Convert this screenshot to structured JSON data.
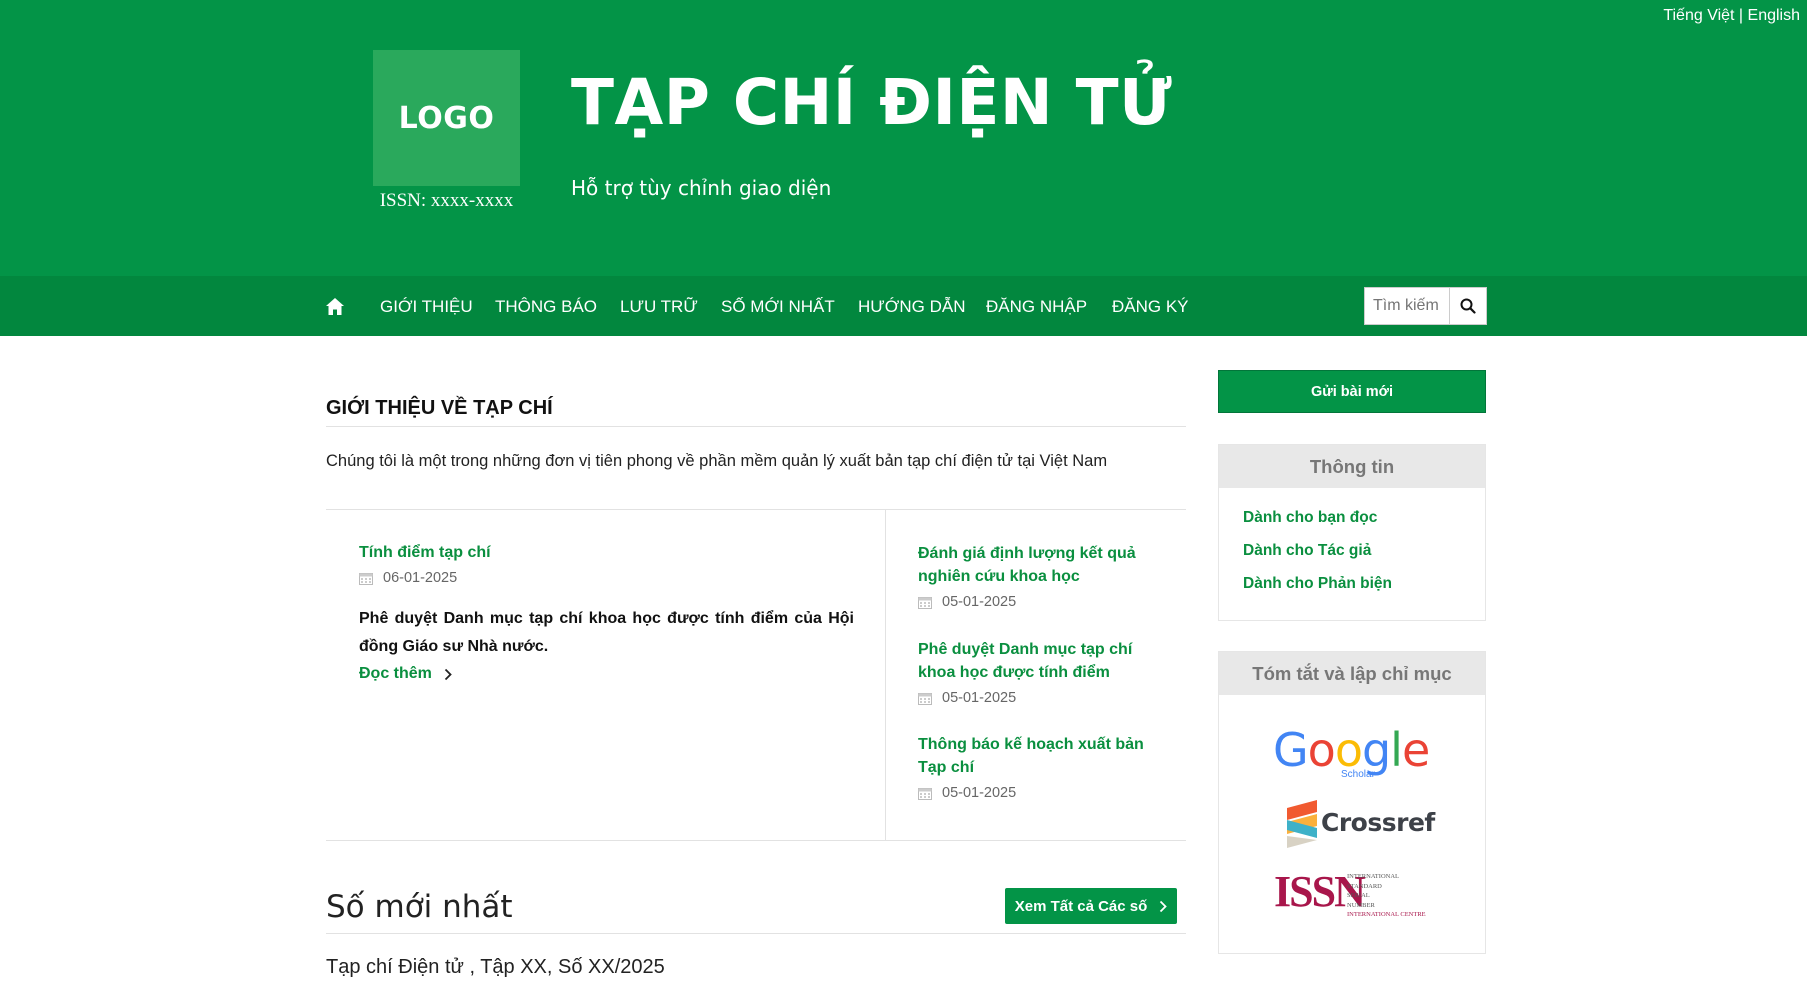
{
  "lang": {
    "vi": "Tiếng Việt",
    "sep": " | ",
    "en": "English"
  },
  "header": {
    "logo_text": "LOGO",
    "issn": "ISSN: xxxx-xxxx",
    "title": "TẠP CHÍ ĐIỆN TỬ",
    "subtitle": "Hỗ trợ tùy chỉnh giao diện",
    "bg_color": "#039447"
  },
  "nav": {
    "home_icon": "home-icon",
    "items": [
      "GIỚI THIỆU",
      "THÔNG BÁO",
      "LƯU TRỮ",
      "SỐ MỚI NHẤT",
      "HƯỚNG DẪN",
      "ĐĂNG NHẬP",
      "ĐĂNG KÝ"
    ],
    "search_placeholder": "Tìm kiếm",
    "search_icon": "search-icon"
  },
  "main": {
    "section_title": "GIỚI THIỆU VỀ TẠP CHÍ",
    "intro": "Chúng tôi là một trong những đơn vị tiên phong về phần mềm quản lý xuất bản tạp chí điện tử tại Việt Nam",
    "featured": {
      "title": "Tính điểm tạp chí",
      "date": "06-01-2025",
      "text": "Phê duyệt Danh mục tạp chí khoa học được tính điểm của Hội đồng Giáo sư Nhà nước.",
      "read_more": "Đọc thêm"
    },
    "side_news": [
      {
        "title": "Đánh giá định lượng kết quả nghiên cứu khoa học",
        "date": "05-01-2025"
      },
      {
        "title": "Phê duyệt Danh mục tạp chí khoa học được tính điểm",
        "date": "05-01-2025"
      },
      {
        "title": "Thông báo kế hoạch xuất bản Tạp chí",
        "date": "05-01-2025"
      }
    ],
    "latest_title": "Số mới nhất",
    "view_all": "Xem Tất cả Các số",
    "issue": "Tạp chí Điện tử , Tập XX, Số XX/2025"
  },
  "sidebar": {
    "submit_label": "Gửi bài mới",
    "info_title": "Thông tin",
    "info_links": [
      "Dành cho bạn đọc",
      "Dành cho Tác giả",
      "Dành cho Phản biện"
    ],
    "index_title": "Tóm tắt và lập chỉ mục",
    "index_logos": {
      "google": {
        "word": "Google",
        "sub": "Scholar"
      },
      "crossref": "Crossref",
      "issn": {
        "mark": "ISSN",
        "lines": [
          "INTERNATIONAL",
          "STANDARD",
          "SERIAL",
          "NUMBER",
          "INTERNATIONAL CENTRE"
        ]
      }
    }
  },
  "colors": {
    "accent": "#039447",
    "nav": "#02873e",
    "link": "#0a8f3f"
  }
}
